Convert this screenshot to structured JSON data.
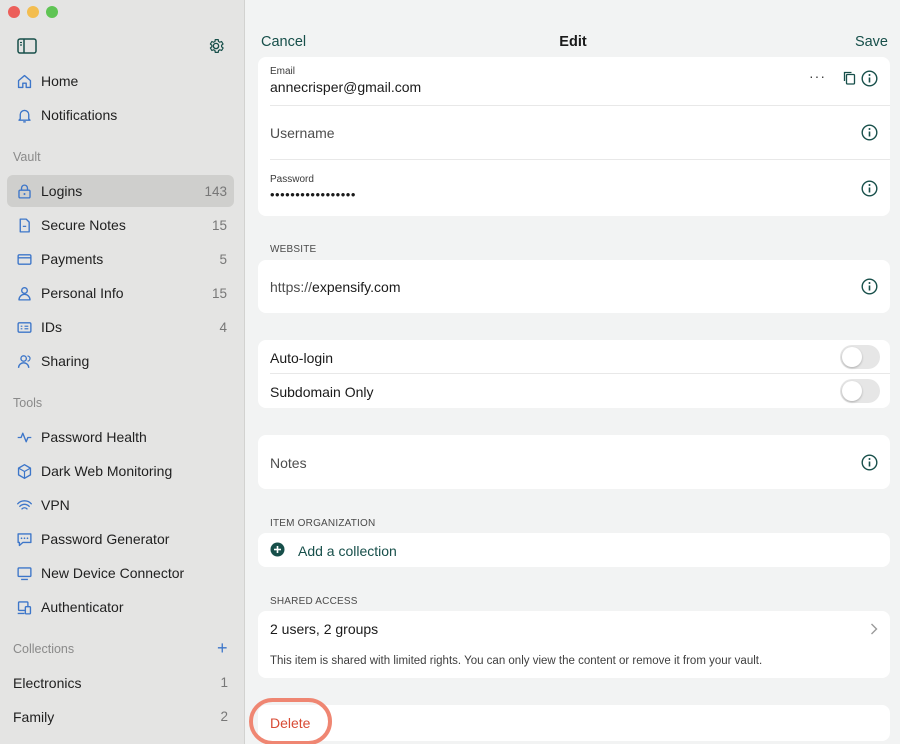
{
  "sidebar": {
    "nav": [
      {
        "label": "Home",
        "icon": "home-icon"
      },
      {
        "label": "Notifications",
        "icon": "bell-icon"
      }
    ],
    "vault_label": "Vault",
    "vault": [
      {
        "label": "Logins",
        "count": "143",
        "icon": "lock-icon",
        "active": true
      },
      {
        "label": "Secure Notes",
        "count": "15",
        "icon": "note-icon"
      },
      {
        "label": "Payments",
        "count": "5",
        "icon": "card-icon"
      },
      {
        "label": "Personal Info",
        "count": "15",
        "icon": "person-icon"
      },
      {
        "label": "IDs",
        "count": "4",
        "icon": "id-icon"
      },
      {
        "label": "Sharing",
        "icon": "sharing-icon"
      }
    ],
    "tools_label": "Tools",
    "tools": [
      {
        "label": "Password Health",
        "icon": "pulse-icon"
      },
      {
        "label": "Dark Web Monitoring",
        "icon": "cube-icon"
      },
      {
        "label": "VPN",
        "icon": "wifi-icon"
      },
      {
        "label": "Password Generator",
        "icon": "chat-dots-icon"
      },
      {
        "label": "New Device Connector",
        "icon": "monitor-icon"
      },
      {
        "label": "Authenticator",
        "icon": "authenticator-icon"
      }
    ],
    "collections_label": "Collections",
    "collections": [
      {
        "label": "Electronics",
        "count": "1"
      },
      {
        "label": "Family",
        "count": "2"
      }
    ]
  },
  "header": {
    "cancel": "Cancel",
    "title": "Edit",
    "save": "Save"
  },
  "credentials": {
    "email_label": "Email",
    "email_value": "annecrisper@gmail.com",
    "username_placeholder": "Username",
    "password_label": "Password",
    "password_value": "•••••••••••••••••"
  },
  "website": {
    "section_label": "WEBSITE",
    "prefix": "https://",
    "domain": "expensify.com"
  },
  "options": {
    "auto_login": "Auto-login",
    "subdomain_only": "Subdomain Only"
  },
  "notes": {
    "placeholder": "Notes"
  },
  "organization": {
    "section_label": "ITEM ORGANIZATION",
    "add_collection": "Add a collection"
  },
  "shared": {
    "section_label": "SHARED ACCESS",
    "users": "2 users, 2 groups",
    "description": "This item is shared with limited rights. You can only view the content or remove it from your vault."
  },
  "delete_label": "Delete",
  "colors": {
    "accent": "#174f4a",
    "nav_icon": "#3d76c9",
    "delete": "#d84b35",
    "highlight_ring": "#ef8672"
  }
}
